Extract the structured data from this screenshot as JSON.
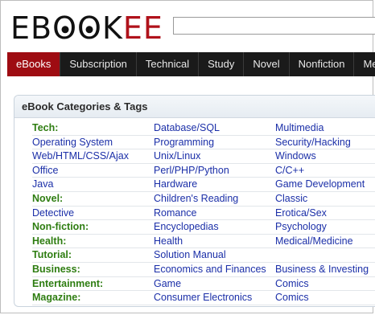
{
  "logo": {
    "parts": [
      "EB",
      "O",
      "O",
      "K",
      "EE"
    ]
  },
  "search": {
    "placeholder": "",
    "value": ""
  },
  "nav": {
    "tabs": [
      "eBooks",
      "Subscription",
      "Technical",
      "Study",
      "Novel",
      "Nonfiction",
      "Medical"
    ]
  },
  "panel": {
    "title": "eBook Categories & Tags"
  },
  "rows": [
    [
      {
        "t": "Tech:",
        "k": "cat"
      },
      {
        "t": "Database/SQL",
        "k": "link"
      },
      {
        "t": "Multimedia",
        "k": "link"
      }
    ],
    [
      {
        "t": "Operating System",
        "k": "link"
      },
      {
        "t": "Programming",
        "k": "link"
      },
      {
        "t": "Security/Hacking",
        "k": "link"
      }
    ],
    [
      {
        "t": "Web/HTML/CSS/Ajax",
        "k": "link"
      },
      {
        "t": "Unix/Linux",
        "k": "link"
      },
      {
        "t": "Windows",
        "k": "link"
      }
    ],
    [
      {
        "t": "Office",
        "k": "link"
      },
      {
        "t": "Perl/PHP/Python",
        "k": "link"
      },
      {
        "t": "C/C++",
        "k": "link"
      }
    ],
    [
      {
        "t": "Java",
        "k": "link"
      },
      {
        "t": "Hardware",
        "k": "link"
      },
      {
        "t": "Game Development",
        "k": "link"
      }
    ],
    [
      {
        "t": "Novel:",
        "k": "cat"
      },
      {
        "t": "Children's Reading",
        "k": "link"
      },
      {
        "t": "Classic",
        "k": "link"
      }
    ],
    [
      {
        "t": "Detective",
        "k": "link"
      },
      {
        "t": "Romance",
        "k": "link"
      },
      {
        "t": "Erotica/Sex",
        "k": "link"
      }
    ],
    [
      {
        "t": "Non-fiction:",
        "k": "cat"
      },
      {
        "t": "Encyclopedias",
        "k": "link"
      },
      {
        "t": "Psychology",
        "k": "link"
      }
    ],
    [
      {
        "t": "Health:",
        "k": "cat"
      },
      {
        "t": "Health",
        "k": "link"
      },
      {
        "t": "Medical/Medicine",
        "k": "link"
      }
    ],
    [
      {
        "t": "Tutorial:",
        "k": "cat"
      },
      {
        "t": "Solution Manual",
        "k": "link"
      },
      {
        "t": "",
        "k": "link"
      }
    ],
    [
      {
        "t": "Business:",
        "k": "cat"
      },
      {
        "t": "Economics and Finances",
        "k": "link"
      },
      {
        "t": "Business & Investing",
        "k": "link"
      }
    ],
    [
      {
        "t": "Entertainment:",
        "k": "cat"
      },
      {
        "t": "Game",
        "k": "link"
      },
      {
        "t": "Comics",
        "k": "link"
      }
    ],
    [
      {
        "t": "Magazine:",
        "k": "cat"
      },
      {
        "t": "Consumer Electronics",
        "k": "link"
      },
      {
        "t": "Comics",
        "k": "link"
      }
    ]
  ],
  "colors": {
    "accent": "#9e0c12",
    "nav_bg": "#1a1a1a",
    "link": "#1b2fa8",
    "category": "#2e7d11"
  }
}
